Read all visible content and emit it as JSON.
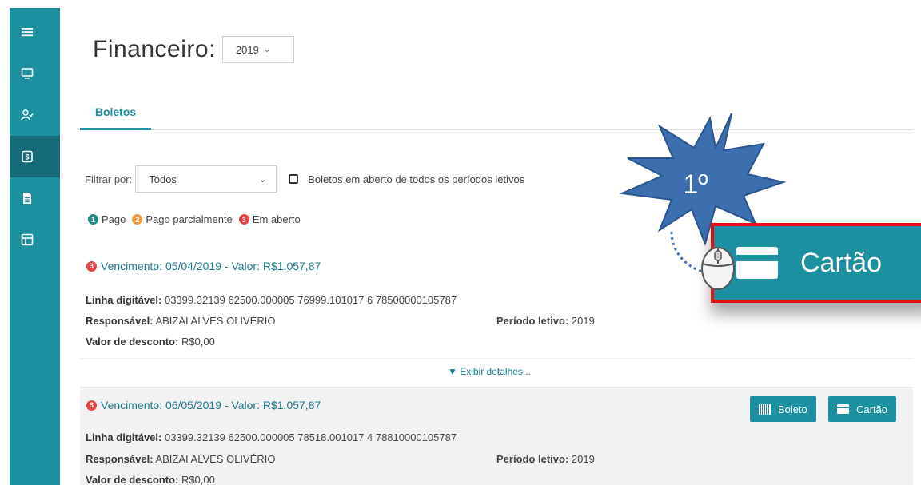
{
  "page": {
    "title": "Financeiro:",
    "year_value": "2019"
  },
  "sidebar": {
    "items": [
      {
        "icon": "menu-icon"
      },
      {
        "icon": "monitor-icon"
      },
      {
        "icon": "user-check-icon"
      },
      {
        "icon": "dollar-doc-icon",
        "active": true
      },
      {
        "icon": "document-icon"
      },
      {
        "icon": "layout-icon"
      }
    ]
  },
  "tabs": {
    "active": "Boletos"
  },
  "filter": {
    "label": "Filtrar por:",
    "value": "Todos",
    "checkbox_label": "Boletos em aberto de todos os períodos letivos"
  },
  "legend": [
    {
      "num": "1",
      "label": "Pago",
      "color": "#1f8a84"
    },
    {
      "num": "2",
      "label": "Pago parcialmente",
      "color": "#f0963a"
    },
    {
      "num": "3",
      "label": "Em aberto",
      "color": "#e84343"
    }
  ],
  "boletos": [
    {
      "status_num": "3",
      "vencimento": "Vencimento: 05/04/2019 - Valor: R$1.057,87",
      "linha_label": "Linha digitável:",
      "linha_value": "03399.32139 62500.000005 76999.101017 6 78500000105787",
      "resp_label": "Responsável:",
      "resp_value": "ABIZAI ALVES OLIVÉRIO",
      "periodo_label": "Período letivo:",
      "periodo_value": "2019",
      "desconto_label": "Valor de desconto:",
      "desconto_value": "R$0,00",
      "detalhes": "▼ Exibir detalhes..."
    },
    {
      "status_num": "3",
      "vencimento": "Vencimento: 06/05/2019 - Valor: R$1.057,87",
      "linha_label": "Linha digitável:",
      "linha_value": "03399.32139 62500.000005 78518.001017 4 78810000105787",
      "resp_label": "Responsável:",
      "resp_value": "ABIZAI ALVES OLIVÉRIO",
      "periodo_label": "Período letivo:",
      "periodo_value": "2019",
      "desconto_label": "Valor de desconto:",
      "desconto_value": "R$0,00",
      "btn_boleto": "Boleto",
      "btn_cartao": "Cartão"
    }
  ],
  "callout": {
    "step": "1º",
    "button_label": "Cartão"
  },
  "colors": {
    "accent": "#1c8fa0",
    "highlight_border": "#e01010",
    "burst": "#3b6fb0"
  }
}
